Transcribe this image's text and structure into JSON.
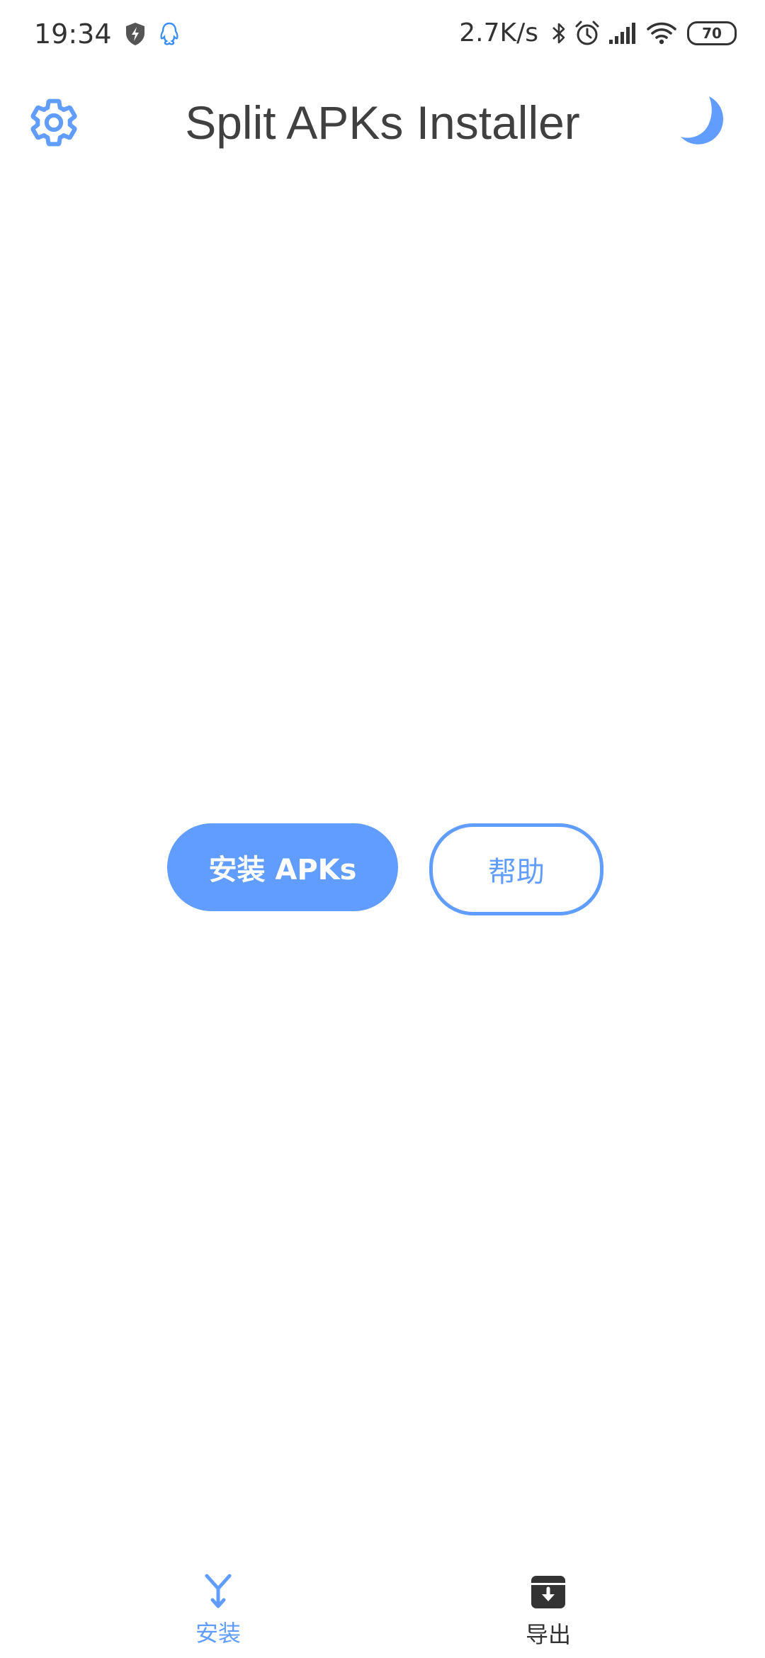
{
  "status_bar": {
    "time": "19:34",
    "network_speed": "2.7K/s",
    "battery": "70",
    "icons": [
      "shield-bolt-icon",
      "qq-penguin-icon",
      "bluetooth-icon",
      "alarm-icon",
      "signal-icon",
      "wifi-icon",
      "battery-icon"
    ]
  },
  "app_bar": {
    "title": "Split APKs Installer",
    "left_icon": "gear-icon",
    "right_icon": "moon-icon"
  },
  "actions": {
    "install_label": "安装 APKs",
    "help_label": "帮助"
  },
  "bottom_nav": {
    "items": [
      {
        "label": "安装",
        "icon": "install-merge-icon",
        "active": true
      },
      {
        "label": "导出",
        "icon": "export-archive-icon",
        "active": false
      }
    ]
  },
  "colors": {
    "accent": "#609dff",
    "text_primary": "#404040",
    "text_dark": "#333333",
    "background": "#ffffff"
  }
}
